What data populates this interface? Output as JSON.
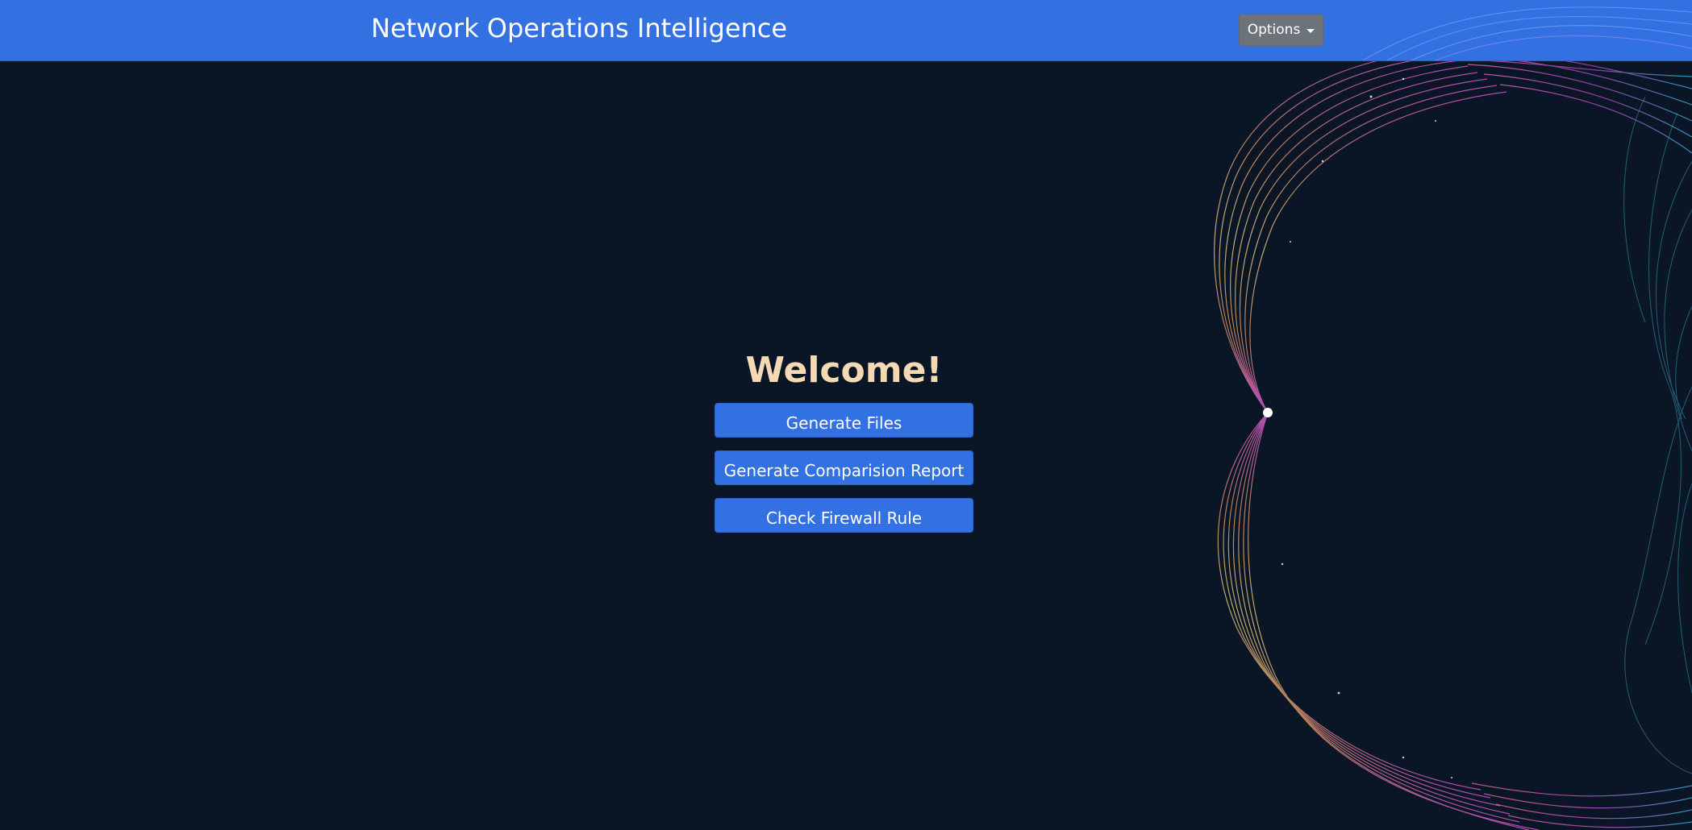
{
  "header": {
    "title": "Network Operations Intelligence",
    "options_label": "Options"
  },
  "main": {
    "welcome": "Welcome!",
    "buttons": [
      {
        "label": "Generate Files"
      },
      {
        "label": "Generate Comparision Report"
      },
      {
        "label": "Check Firewall Rule"
      }
    ]
  },
  "colors": {
    "navbar": "#3371e3",
    "background": "#0a1526",
    "button": "#3371e3",
    "welcome_text": "#f4d9b3",
    "options_button": "#6c737a"
  },
  "icons": {
    "options_caret": "caret-down-icon"
  }
}
